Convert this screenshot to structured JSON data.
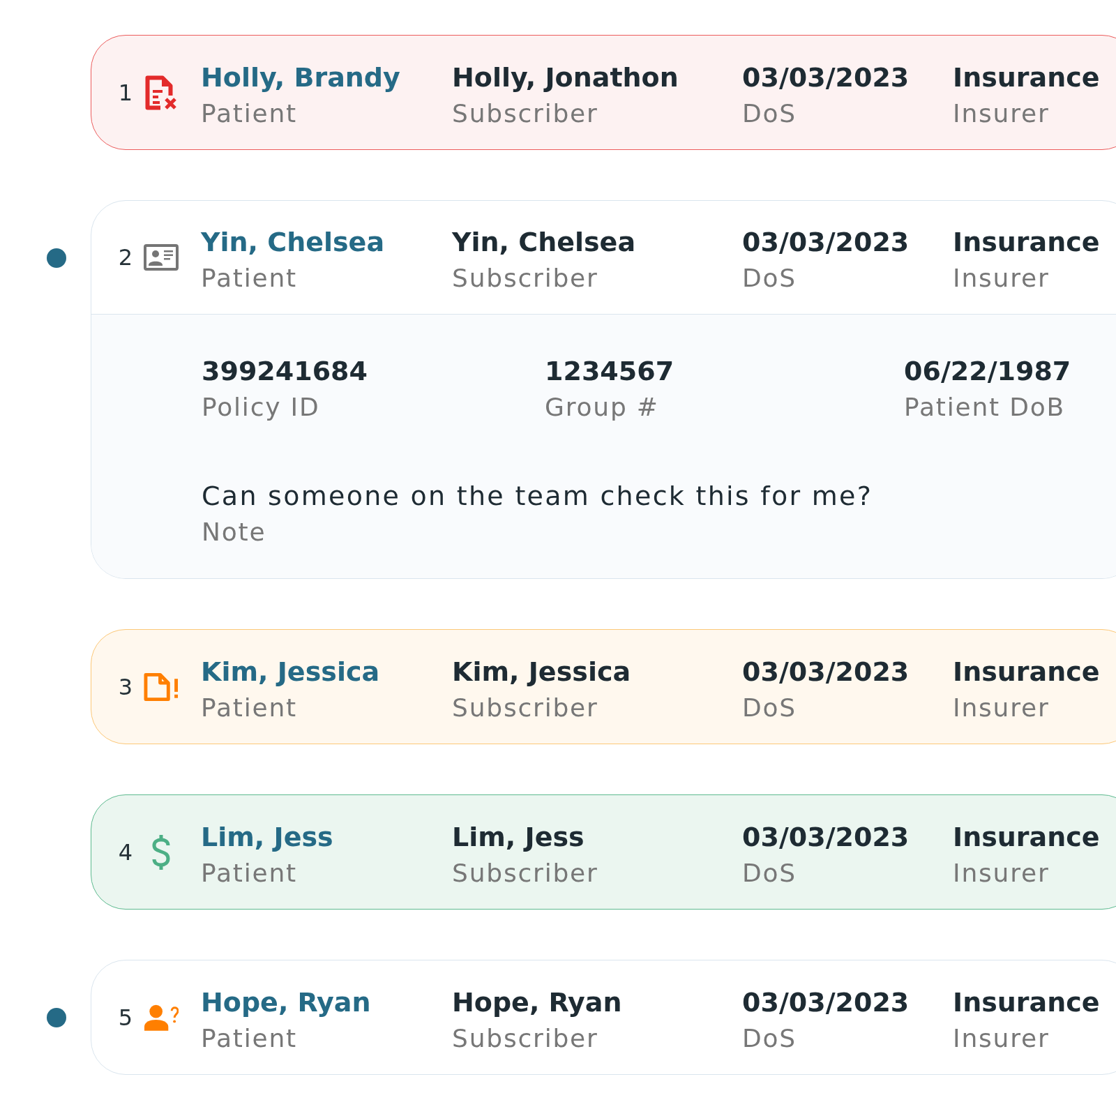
{
  "rows": [
    {
      "number": "1",
      "kind": "error",
      "unread": false,
      "expanded": false,
      "fields": [
        {
          "value": "Holly, Brandy",
          "label": "Patient"
        },
        {
          "value": "Holly, Jonathon",
          "label": "Subscriber"
        },
        {
          "value": "03/03/2023",
          "label": "DoS"
        },
        {
          "value": "Insurance",
          "label": "Insurer"
        }
      ]
    },
    {
      "number": "2",
      "kind": "idcard",
      "unread": true,
      "expanded": true,
      "fields": [
        {
          "value": "Yin, Chelsea",
          "label": "Patient"
        },
        {
          "value": "Yin, Chelsea",
          "label": "Subscriber"
        },
        {
          "value": "03/03/2023",
          "label": "DoS"
        },
        {
          "value": "Insurance",
          "label": "Insurer"
        }
      ],
      "details": [
        {
          "value": "399241684",
          "label": "Policy ID"
        },
        {
          "value": "1234567",
          "label": "Group #"
        },
        {
          "value": "06/22/1987",
          "label": "Patient DoB"
        }
      ],
      "note": {
        "text": "Can someone on the team check this for me?",
        "label": "Note"
      }
    },
    {
      "number": "3",
      "kind": "alert",
      "unread": false,
      "expanded": false,
      "fields": [
        {
          "value": "Kim, Jessica",
          "label": "Patient"
        },
        {
          "value": "Kim, Jessica",
          "label": "Subscriber"
        },
        {
          "value": "03/03/2023",
          "label": "DoS"
        },
        {
          "value": "Insurance",
          "label": "Insurer"
        }
      ]
    },
    {
      "number": "4",
      "kind": "dollar",
      "unread": false,
      "expanded": false,
      "fields": [
        {
          "value": "Lim, Jess",
          "label": "Patient"
        },
        {
          "value": "Lim, Jess",
          "label": "Subscriber"
        },
        {
          "value": "03/03/2023",
          "label": "DoS"
        },
        {
          "value": "Insurance",
          "label": "Insurer"
        }
      ]
    },
    {
      "number": "5",
      "kind": "question",
      "unread": true,
      "expanded": false,
      "fields": [
        {
          "value": "Hope, Ryan",
          "label": "Patient"
        },
        {
          "value": "Hope, Ryan",
          "label": "Subscriber"
        },
        {
          "value": "03/03/2023",
          "label": "DoS"
        },
        {
          "value": "Insurance",
          "label": "Insurer"
        }
      ]
    }
  ]
}
